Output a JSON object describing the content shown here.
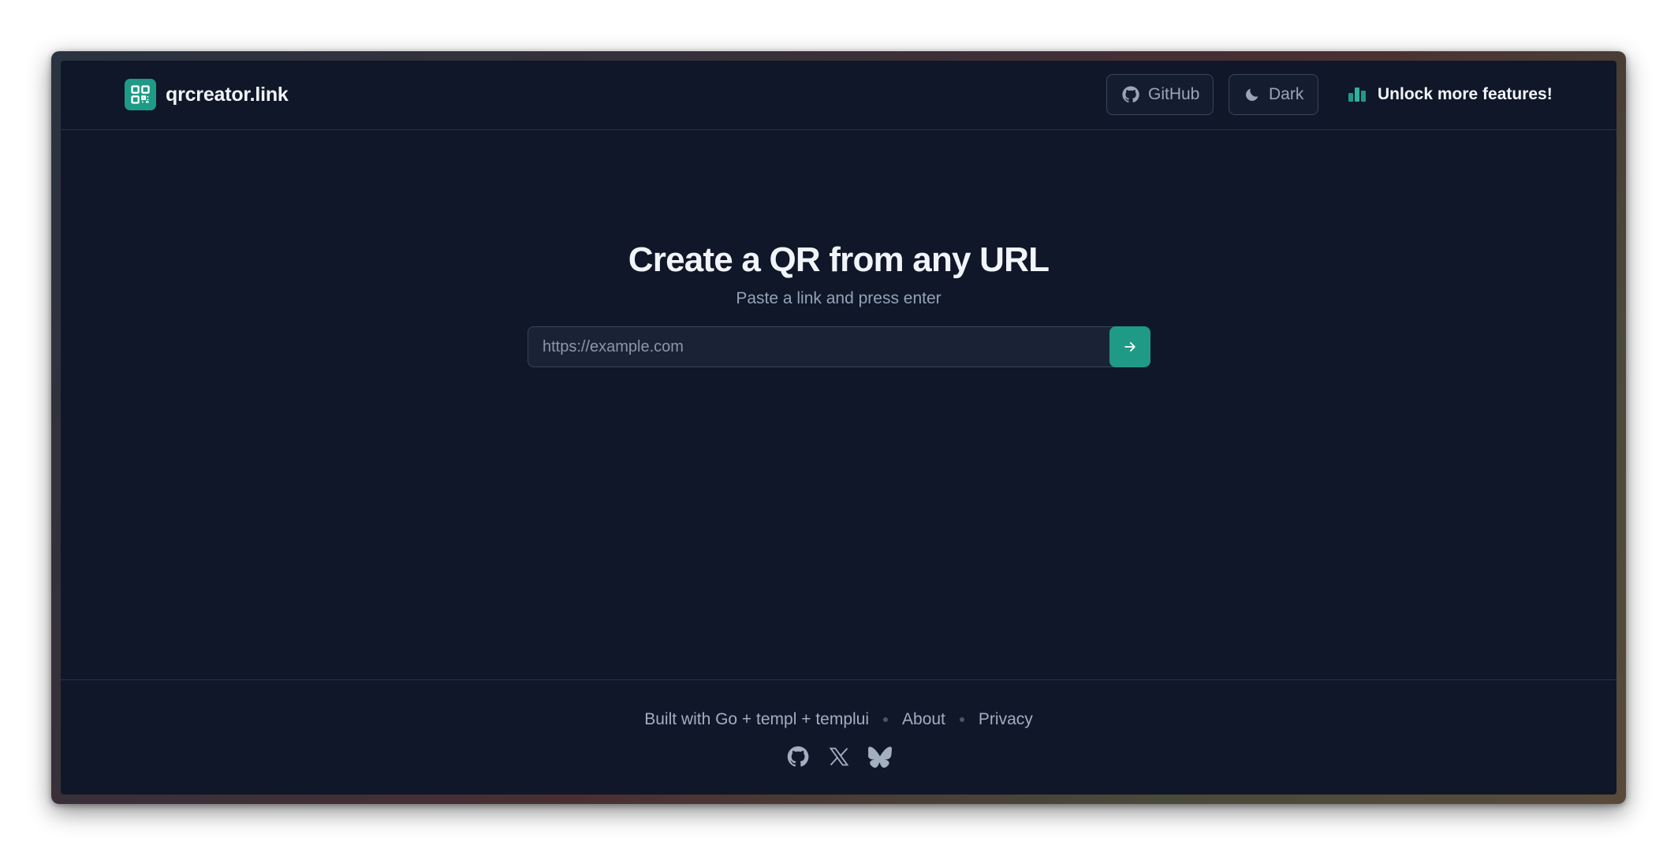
{
  "header": {
    "brand_name": "qrcreator.link",
    "github_label": "GitHub",
    "theme_label": "Dark",
    "unlock_label": "Unlock more features!"
  },
  "hero": {
    "title": "Create a QR from any URL",
    "subtitle": "Paste a link and press enter"
  },
  "search": {
    "placeholder": "https://example.com",
    "value": ""
  },
  "footer": {
    "built_with": "Built with Go + templ + templui",
    "about": "About",
    "privacy": "Privacy",
    "social_icons": [
      "github-icon",
      "x-icon",
      "bluesky-icon"
    ]
  },
  "colors": {
    "background": "#0f1729",
    "accent": "#1f9a86",
    "border": "#2a3548",
    "muted_text": "#94a3b8"
  }
}
